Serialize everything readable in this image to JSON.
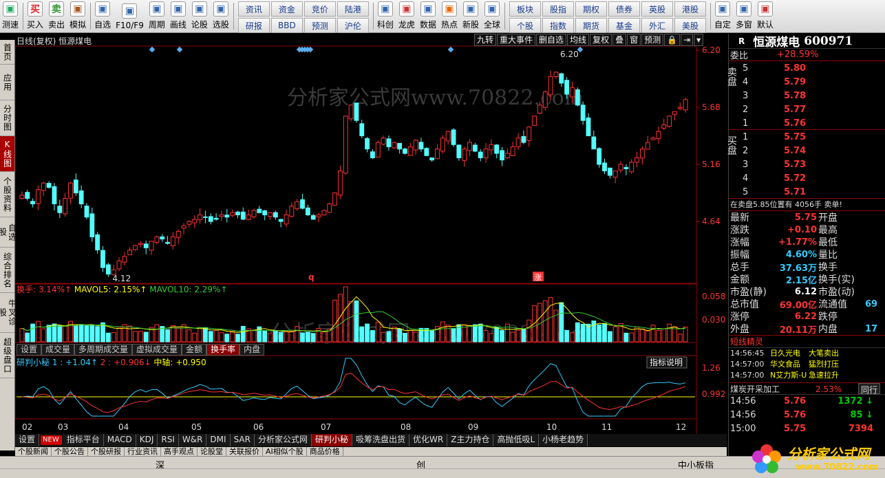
{
  "toolbar": {
    "left_buttons": [
      {
        "label": "测速",
        "icon": "clock-icon"
      },
      {
        "label": "买入",
        "icon": "buy-icon",
        "glyph": "买"
      },
      {
        "label": "卖出",
        "icon": "sell-icon",
        "glyph": "卖"
      },
      {
        "label": "模拟",
        "icon": "hammer-icon"
      },
      {
        "label": "自选",
        "icon": "star-icon"
      },
      {
        "label": "F10/F9",
        "icon": "f10-icon"
      },
      {
        "label": "周期",
        "icon": "cycle-icon"
      },
      {
        "label": "画线",
        "icon": "pencil-icon"
      },
      {
        "label": "论股",
        "icon": "discuss-icon"
      },
      {
        "label": "选股",
        "icon": "select-stock-icon"
      }
    ],
    "grid_a": [
      "资讯",
      "资金",
      "竞价",
      "陆港",
      "研报",
      "BBD",
      "预测",
      "沪伦"
    ],
    "mid_buttons": [
      {
        "label": "科创",
        "icon": "kechuang-icon"
      },
      {
        "label": "龙虎",
        "icon": "tiger-icon"
      },
      {
        "label": "数据",
        "icon": "pe-data-icon"
      },
      {
        "label": "热点",
        "icon": "hot-icon"
      },
      {
        "label": "新股",
        "icon": "ipo-icon"
      },
      {
        "label": "全球",
        "icon": "globe-icon"
      }
    ],
    "grid_b": [
      "板块",
      "股指",
      "期权",
      "债券",
      "英股",
      "个股",
      "指数",
      "期货",
      "基金",
      "外汇"
    ],
    "grid_b_extra": [
      "港股",
      "美股"
    ],
    "right_buttons": [
      {
        "label": "自定",
        "icon": "custom-icon"
      },
      {
        "label": "多窗",
        "icon": "multiwindow-icon"
      },
      {
        "label": "默认",
        "icon": "home-icon"
      }
    ]
  },
  "left_tabs": [
    {
      "label": "首页",
      "active": false
    },
    {
      "label": "应用",
      "active": false
    },
    {
      "label": "分时图",
      "active": false
    },
    {
      "label": "K线图",
      "active": true
    },
    {
      "label": "个股资料",
      "active": false
    },
    {
      "label": "自选股",
      "active": false
    },
    {
      "label": "综合排名",
      "active": false
    },
    {
      "label": "牛叉诊股",
      "active": false
    },
    {
      "label": "超级盘口",
      "active": false
    }
  ],
  "chart": {
    "header": "日线(复权) 恒源煤电",
    "tools": [
      "九转",
      "重大事件",
      "删自选",
      "均线",
      "复权",
      "叠",
      "窗",
      "预测",
      "🔒",
      "⇥",
      "▾"
    ],
    "price_axis": [
      "6.20",
      "5.68",
      "5.16",
      "4.64"
    ],
    "high_label": "6.20",
    "low_label": "4.12",
    "month_labels": [
      "02",
      "03",
      "04",
      "05",
      "06",
      "07",
      "08",
      "09",
      "10",
      "11",
      "12"
    ],
    "watermark1": "分析家公式网www.70822.com",
    "watermark2": "分析家公式网www.70822.Com",
    "marker_q": "q",
    "marker_zhang": "涨",
    "vol_header": {
      "a": "换手: 3.14%↑",
      "b": "MAVOL5: 2.15%↑",
      "c": "MAVOL10: 2.29%↑"
    },
    "vol_axis": [
      "0.058",
      "0.030"
    ],
    "vol_tabs": [
      {
        "label": "设置",
        "on": false
      },
      {
        "label": "成交量",
        "on": false
      },
      {
        "label": "多周期成交量",
        "on": false
      },
      {
        "label": "虚拟成交量",
        "on": false
      },
      {
        "label": "金额",
        "on": false
      },
      {
        "label": "换手率",
        "on": true
      },
      {
        "label": "内盘",
        "on": false
      }
    ],
    "ind_header": {
      "a": "研判小秘",
      "b": "1 : +1.04↑",
      "c": "2 : +0.906↓",
      "d": "中轴: +0.950"
    },
    "ind_explain": "指标说明",
    "ind_axis": [
      "1.26",
      "0.992"
    ]
  },
  "bottom_tabs": [
    "设置",
    "NEW",
    "指标平台",
    "MACD",
    "KDJ",
    "RSI",
    "W&R",
    "DMI",
    "SAR",
    "分析家公式网",
    "研判小秘",
    "吸筹洗盘出货",
    "优化WR",
    "Z主力持仓",
    "高抛低吸L",
    "小杨老趋势"
  ],
  "bottom_active": "研判小秘",
  "news_tabs": [
    "个股新闻",
    "个股公告",
    "个股研报",
    "行业资讯",
    "高手观点",
    "论股堂",
    "关联报价",
    "AI相似个股",
    "商品价格"
  ],
  "status": {
    "left": "深",
    "mid": "创",
    "right": "中小板指"
  },
  "quote": {
    "r_label": "R",
    "name": "恒源煤电",
    "code": "600971",
    "weibi_label": "委比",
    "weibi": "+28.59%",
    "sell_label": "卖盘",
    "buy_label": "买盘",
    "asks": [
      [
        "5",
        "5.80"
      ],
      [
        "4",
        "5.79"
      ],
      [
        "3",
        "5.78"
      ],
      [
        "2",
        "5.77"
      ],
      [
        "1",
        "5.76"
      ]
    ],
    "bids": [
      [
        "1",
        "5.75"
      ],
      [
        "2",
        "5.74"
      ],
      [
        "3",
        "5.73"
      ],
      [
        "4",
        "5.72"
      ],
      [
        "5",
        "5.71"
      ]
    ],
    "notice": "在卖盘5.85位置有 4056手 卖单!",
    "stats": [
      [
        "最新",
        "5.75",
        "开盘",
        ""
      ],
      [
        "涨跌",
        "+0.10",
        "最高",
        ""
      ],
      [
        "涨幅",
        "+1.77%",
        "最低",
        ""
      ],
      [
        "振幅",
        "4.60%",
        "量比",
        ""
      ],
      [
        "总手",
        "37.63万",
        "换手",
        ""
      ],
      [
        "金额",
        "2.15亿",
        "换手(实)",
        ""
      ],
      [
        "市盈(静)",
        "6.12",
        "市盈(动)",
        ""
      ],
      [
        "总市值",
        "69.00亿",
        "流通值",
        "69"
      ],
      [
        "涨停",
        "6.22",
        "跌停",
        ""
      ],
      [
        "外盘",
        "20.11万",
        "内盘",
        "17"
      ]
    ],
    "sprite_title": "短线精灵",
    "sprites": [
      [
        "14:56:45",
        "日久光电",
        "大笔卖出"
      ],
      [
        "14:57:00",
        "华文食品",
        "猛烈打压"
      ],
      [
        "14:57:00",
        "N艾力斯-U",
        "急速拉升"
      ]
    ],
    "sector": "煤炭开采加工",
    "sector_pct": "2.53%",
    "sector_tab": "同行",
    "ticks": [
      [
        "14:56",
        "5.76",
        "1372"
      ],
      [
        "14:56",
        "5.76",
        "85"
      ],
      [
        "15:00",
        "5.75",
        "7394"
      ]
    ]
  },
  "logo_text": "分析家公式网",
  "logo_url": "www.70822.com",
  "chart_data": {
    "type": "candlestick",
    "title": "日线(复权) 恒源煤电",
    "ylim": [
      4.12,
      6.2
    ],
    "high": 6.2,
    "low": 4.12,
    "months": [
      "02",
      "03",
      "04",
      "05",
      "06",
      "07",
      "08",
      "09",
      "10",
      "11",
      "12"
    ],
    "closes": [
      4.88,
      4.85,
      4.8,
      4.93,
      4.99,
      4.95,
      4.8,
      4.72,
      4.85,
      4.99,
      4.9,
      4.8,
      4.68,
      4.5,
      4.38,
      4.22,
      4.16,
      4.2,
      4.28,
      4.32,
      4.38,
      4.42,
      4.44,
      4.4,
      4.46,
      4.5,
      4.48,
      4.44,
      4.5,
      4.55,
      4.6,
      4.64,
      4.66,
      4.7,
      4.68,
      4.64,
      4.66,
      4.7,
      4.68,
      4.72,
      4.7,
      4.66,
      4.7,
      4.74,
      4.72,
      4.7,
      4.72,
      4.68,
      4.64,
      4.7,
      4.78,
      4.82,
      4.76,
      4.7,
      4.66,
      4.7,
      4.74,
      4.8,
      4.9,
      5.1,
      5.6,
      5.7,
      5.56,
      5.42,
      5.3,
      5.22,
      5.36,
      5.4,
      5.32,
      5.36,
      5.3,
      5.26,
      5.32,
      5.38,
      5.3,
      5.24,
      5.2,
      5.3,
      5.4,
      5.46,
      5.34,
      5.22,
      5.3,
      5.36,
      5.28,
      5.22,
      5.3,
      5.34,
      5.26,
      5.2,
      5.26,
      5.32,
      5.4,
      5.36,
      5.5,
      5.6,
      5.7,
      5.82,
      5.96,
      6.0,
      5.9,
      5.8,
      5.86,
      5.7,
      5.56,
      5.42,
      5.3,
      5.16,
      5.1,
      5.06,
      5.1,
      5.16,
      5.12,
      5.18,
      5.22,
      5.3,
      5.36,
      5.4,
      5.46,
      5.52,
      5.6,
      5.64,
      5.68,
      5.75
    ]
  }
}
